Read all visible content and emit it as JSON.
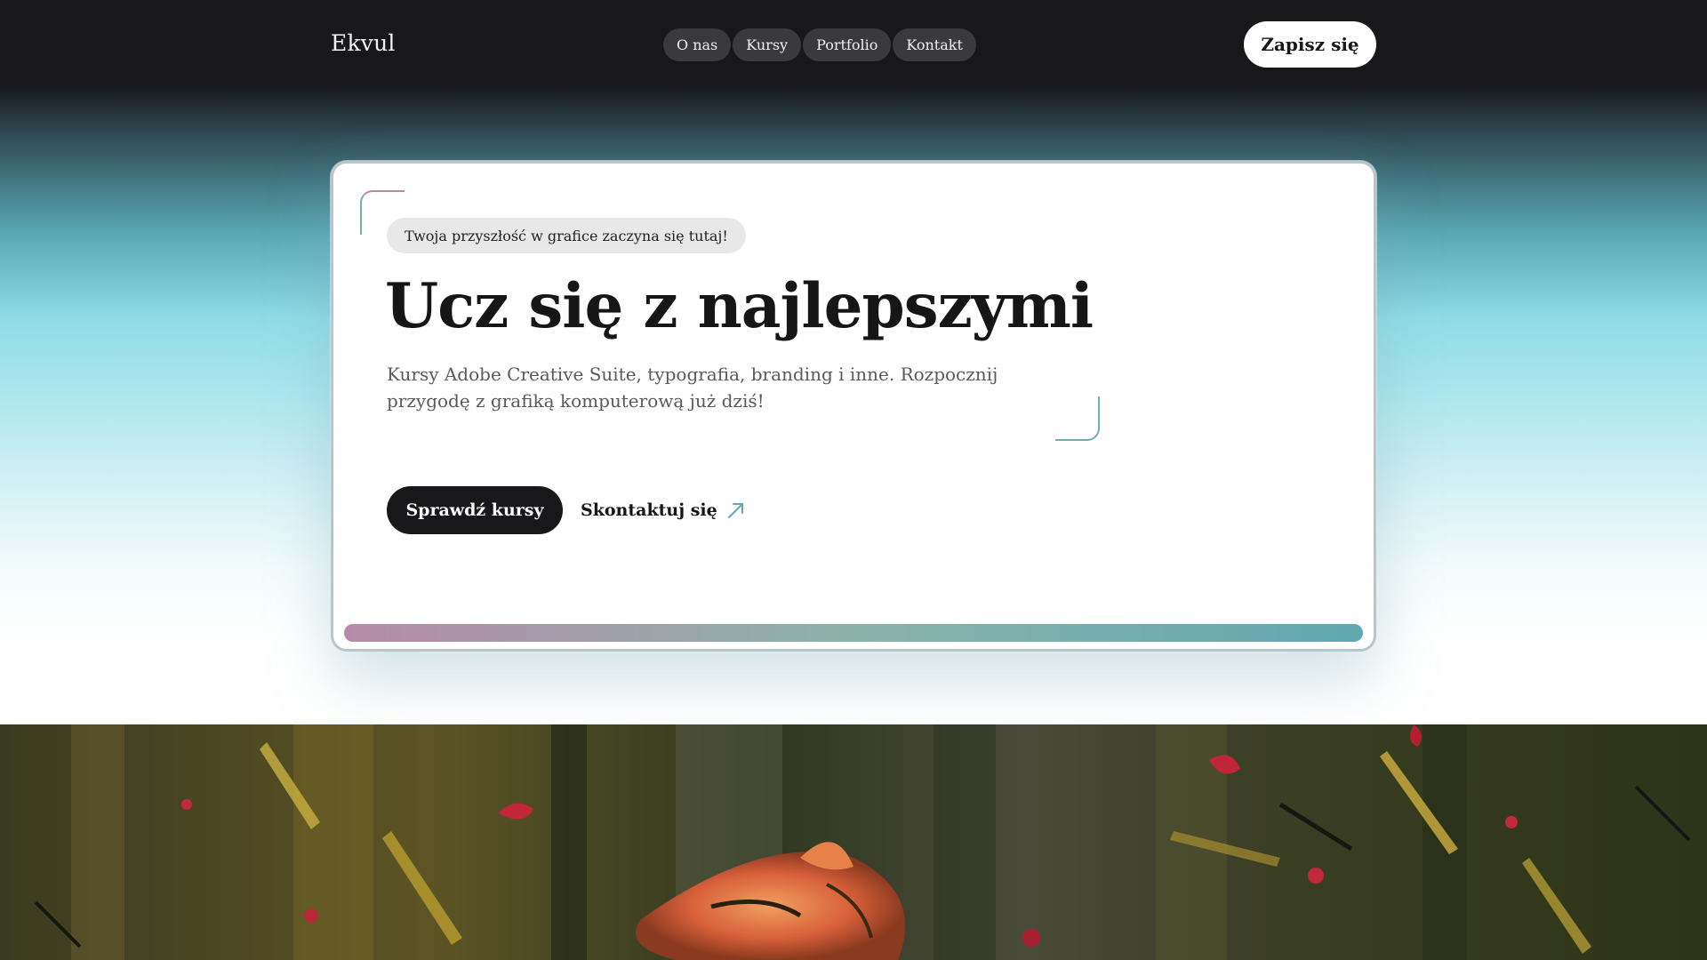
{
  "header": {
    "logo": "Ekvul",
    "nav": [
      {
        "label": "O nas"
      },
      {
        "label": "Kursy"
      },
      {
        "label": "Portfolio"
      },
      {
        "label": "Kontakt"
      }
    ],
    "cta_label": "Zapisz się"
  },
  "hero": {
    "badge": "Twoja przyszłość w grafice zaczyna się tutaj!",
    "title": "Ucz się z najlepszymi",
    "subtitle": "Kursy Adobe Creative Suite, typografia, branding i inne. Rozpocznij przygodę z grafiką komputerową już dziś!",
    "primary_button": "Sprawdź kursy",
    "secondary_link": "Skontaktuj się",
    "secondary_icon": "arrow-up-right-icon"
  },
  "colors": {
    "dark": "#18181a",
    "accent_teal": "#5fa8b0",
    "accent_mauve": "#b58aa8",
    "accent_sage": "#8cb3aa"
  }
}
